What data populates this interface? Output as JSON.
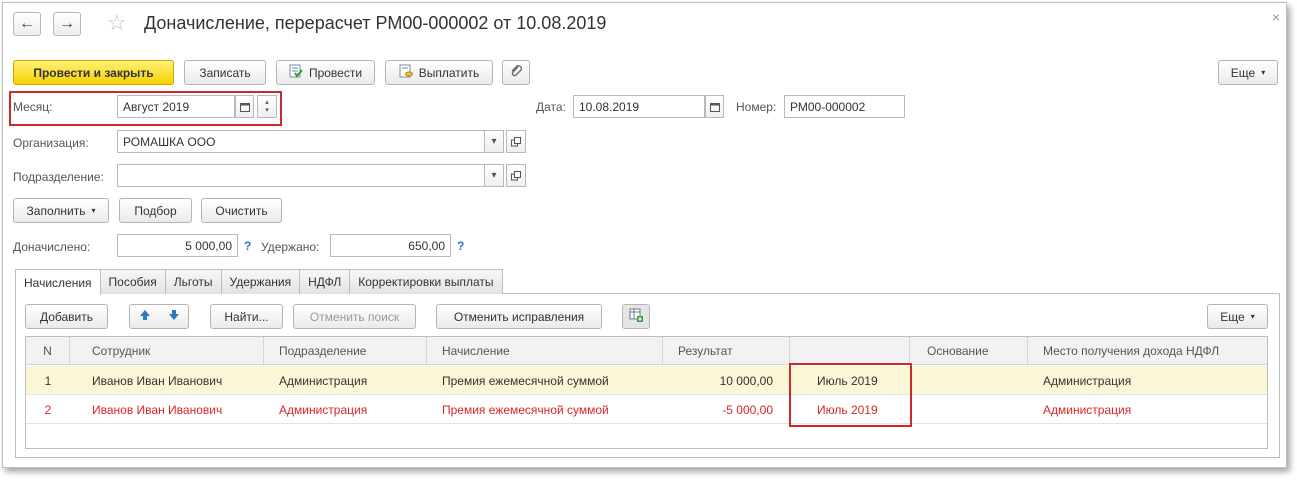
{
  "window": {
    "title": "Доначисление, перерасчет РМ00-000002 от 10.08.2019",
    "back_icon": "←",
    "forward_icon": "→",
    "star_icon": "☆",
    "close_icon": "×"
  },
  "toolbar": {
    "post_close": "Провести и закрыть",
    "save": "Записать",
    "post": "Провести",
    "pay": "Выплатить",
    "more": "Еще"
  },
  "form": {
    "month_label": "Месяц:",
    "month_value": "Август 2019",
    "date_label": "Дата:",
    "date_value": "10.08.2019",
    "number_label": "Номер:",
    "number_value": "РМ00-000002",
    "org_label": "Организация:",
    "org_value": "РОМАШКА ООО",
    "dept_label": "Подразделение:",
    "dept_value": "",
    "fill_button": "Заполнить",
    "pick_button": "Подбор",
    "clear_button": "Очистить",
    "accrued_label": "Доначислено:",
    "accrued_value": "5 000,00",
    "withheld_label": "Удержано:",
    "withheld_value": "650,00",
    "help": "?"
  },
  "tabs": [
    "Начисления",
    "Пособия",
    "Льготы",
    "Удержания",
    "НДФЛ",
    "Корректировки выплаты"
  ],
  "table_toolbar": {
    "add": "Добавить",
    "find": "Найти...",
    "cancel_search": "Отменить поиск",
    "cancel_corrections": "Отменить исправления",
    "more": "Еще"
  },
  "table": {
    "columns": [
      "N",
      "Сотрудник",
      "Подразделение",
      "Начисление",
      "Результат",
      "",
      "Основание",
      "Место получения дохода НДФЛ"
    ],
    "rows": [
      {
        "n": "1",
        "employee": "Иванов Иван Иванович",
        "dept": "Администрация",
        "accrual": "Премия ежемесячной суммой",
        "result": "10 000,00",
        "period": "Июль 2019",
        "basis": "",
        "place": "Администрация"
      },
      {
        "n": "2",
        "employee": "Иванов Иван Иванович",
        "dept": "Администрация",
        "accrual": "Премия ежемесячной суммой",
        "result": "-5 000,00",
        "period": "Июль 2019",
        "basis": "",
        "place": "Администрация"
      }
    ]
  },
  "colors": {
    "primary_button": "#f5d200",
    "highlight_box": "#cc2a2a",
    "negative_row_text": "#d9252a",
    "selected_row": "#fbf6d6"
  }
}
